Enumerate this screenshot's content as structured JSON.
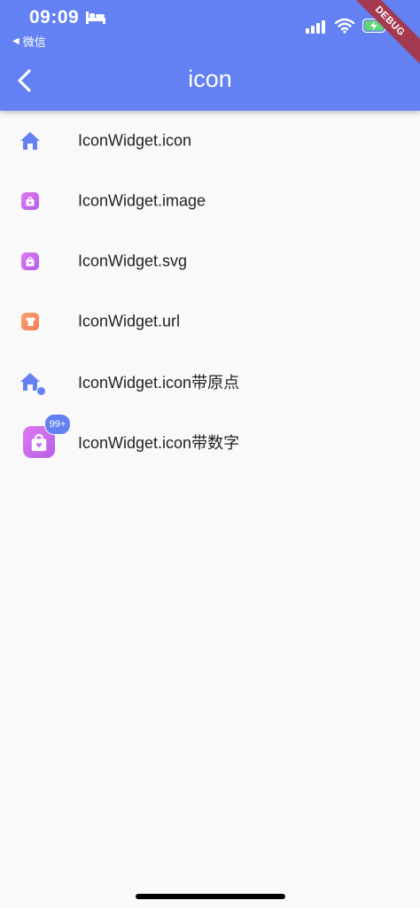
{
  "status_bar": {
    "time": "09:09",
    "back_app": "微信"
  },
  "debug_banner": "DEBUG",
  "app_bar": {
    "title": "icon"
  },
  "items": [
    {
      "label": "IconWidget.icon",
      "icon": "home-icon"
    },
    {
      "label": "IconWidget.image",
      "icon": "shopping-bag-icon"
    },
    {
      "label": "IconWidget.svg",
      "icon": "shopping-bag-icon"
    },
    {
      "label": "IconWidget.url",
      "icon": "shirt-icon"
    },
    {
      "label": "IconWidget.icon带原点",
      "icon": "home-icon"
    },
    {
      "label": "IconWidget.icon带数字",
      "icon": "shopping-bag-icon",
      "badge": "99+"
    }
  ],
  "colors": {
    "primary": "#6381f2",
    "debug": "#a33a50",
    "bag": "#c86cec",
    "shirt": "#f4905f"
  }
}
